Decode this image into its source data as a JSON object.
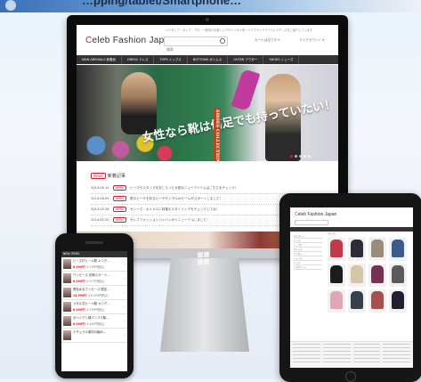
{
  "banner": {
    "promo_text": "…pping/tablet/Smartphone…"
  },
  "desktop": {
    "tagline": "ハイセレブ・セレブ・プロ・一般向けの新しいデザインの人気・ハイブランドアイテムやグッズをご紹介しています",
    "logo_first": "C",
    "logo_rest": "eleb Fashion Japan",
    "search_placeholder": "検索",
    "cart_label": "カートは空です ▾",
    "mypage_label": "マイアカウント ▾",
    "nav": [
      "NEW ARRIVALS 新着品",
      "DRESS ドレス",
      "TOPS トップス",
      "BOTTOMS ボトムス",
      "OUTER アウター",
      "SHOES シューズ"
    ],
    "hero_copy": "女性なら靴は何足でも持っていたい！",
    "hero_vertical": "SHOES COLLECTION",
    "news_badge": "News",
    "news_heading": "新着記事",
    "news": [
      {
        "date": "2014.06.10",
        "tag": "NEWS",
        "text": "ビーズやスタッズをあしらった大胆なニューアイテムはこちらをチェック！"
      },
      {
        "date": "2014.06.05",
        "tag": "NEWS",
        "text": "夏のビーチを彩るビーチサンダルのセールがスタートしました！"
      },
      {
        "date": "2014.05.28",
        "tag": "NEWS",
        "text": "セレーズ・キャメロン特集のスタイリングをチェックしてね！"
      },
      {
        "date": "2014.05.20",
        "tag": "NEWS",
        "text": "セレブファッションジャパンがリニューアルしました！"
      }
    ],
    "bottom_banner": "ゼント"
  },
  "phone": {
    "header": "NEW ITEMS",
    "items": [
      {
        "name": "ビーズ付ヒール靴 キング…",
        "price": "8,990円",
        "tax": "(9,709円税込)"
      },
      {
        "name": "ワンピース 花柄スカート…",
        "price": "8,990円",
        "tax": "(9,372円税込)"
      },
      {
        "name": "黒色水玉ワンピース 限定…",
        "price": "14,990円",
        "tax": "(16,059円税込)"
      },
      {
        "name": "メタル花ヒール靴 キング…",
        "price": "8,990円",
        "tax": "(9,709円税込)"
      },
      {
        "name": "ボヘミアン調パンプス靴…",
        "price": "8,990円",
        "tax": "(9,404円税込)"
      },
      {
        "name": "ナチュラル素材の編み…",
        "price": "",
        "tax": ""
      }
    ]
  },
  "tablet": {
    "logo_first": "C",
    "logo_rest": "eleb Fashion Japan",
    "category_title": "ドレス",
    "sidebar": [
      "カテゴリー",
      "ドレス",
      "トップス",
      "ボトムス",
      "アウター",
      "シューズ",
      "バッグ",
      "アクセサリー"
    ]
  },
  "colors": {
    "brand_red": "#d21d38",
    "nav_dark": "#333333"
  }
}
